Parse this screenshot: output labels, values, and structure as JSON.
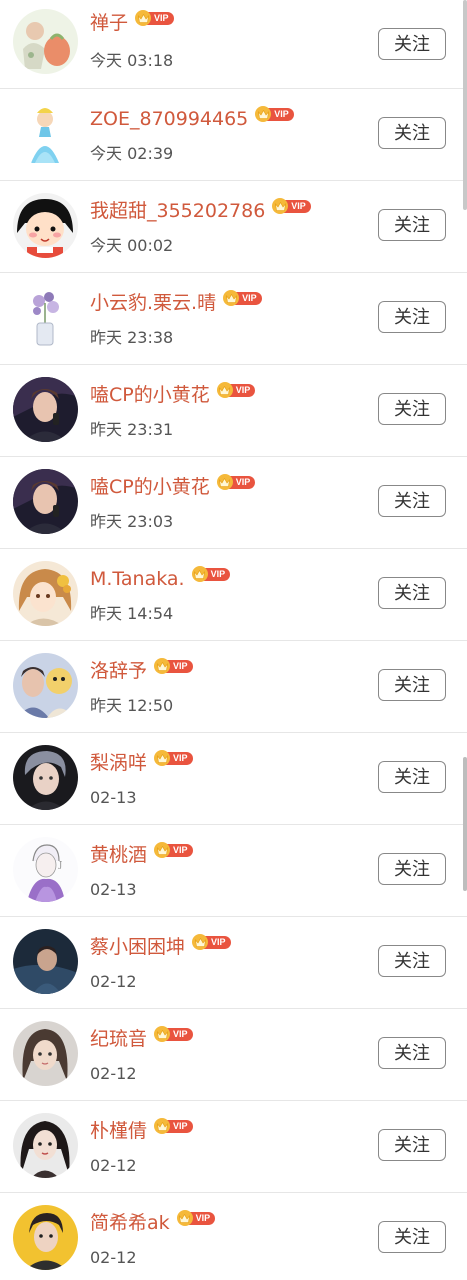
{
  "follow_label": "关注",
  "vip_label": "VIP",
  "colors": {
    "name": "#d0593c",
    "vip_badge": "#e9543f",
    "vip_crown": "#f5b93a",
    "time": "#555555",
    "button_border": "#888888"
  },
  "users": [
    {
      "name": "禅子",
      "time": "今天 03:18",
      "avatar": "avatar-pastel-drawing",
      "vip": true
    },
    {
      "name": "ZOE_870994465",
      "time": "今天 02:39",
      "avatar": "avatar-cinderella",
      "vip": true
    },
    {
      "name": "我超甜_355202786",
      "time": "今天 00:02",
      "avatar": "avatar-chibi-maruko",
      "vip": true
    },
    {
      "name": "小云豹.栗云.晴",
      "time": "昨天 23:38",
      "avatar": "avatar-flowers-vase",
      "vip": true
    },
    {
      "name": "嗑CP的小黄花",
      "time": "昨天 23:31",
      "avatar": "avatar-singer-photo",
      "vip": true
    },
    {
      "name": "嗑CP的小黄花",
      "time": "昨天 23:03",
      "avatar": "avatar-singer-photo",
      "vip": true
    },
    {
      "name": "M.Tanaka.",
      "time": "昨天 14:54",
      "avatar": "avatar-anime-girl",
      "vip": true
    },
    {
      "name": "洛辞予",
      "time": "昨天 12:50",
      "avatar": "avatar-plush-photo",
      "vip": true
    },
    {
      "name": "梨涡咩",
      "time": "02-13",
      "avatar": "avatar-portrait-photo",
      "vip": true
    },
    {
      "name": "黄桃酒",
      "time": "02-13",
      "avatar": "avatar-sketch-purple",
      "vip": true
    },
    {
      "name": "蔡小困困坤",
      "time": "02-12",
      "avatar": "avatar-stage-photo",
      "vip": true
    },
    {
      "name": "纪琉音",
      "time": "02-12",
      "avatar": "avatar-girl-photo",
      "vip": true
    },
    {
      "name": "朴槿倩",
      "time": "02-12",
      "avatar": "avatar-woman-photo",
      "vip": true
    },
    {
      "name": "简希希ak",
      "time": "02-12",
      "avatar": "avatar-yellow-photo",
      "vip": true
    }
  ]
}
